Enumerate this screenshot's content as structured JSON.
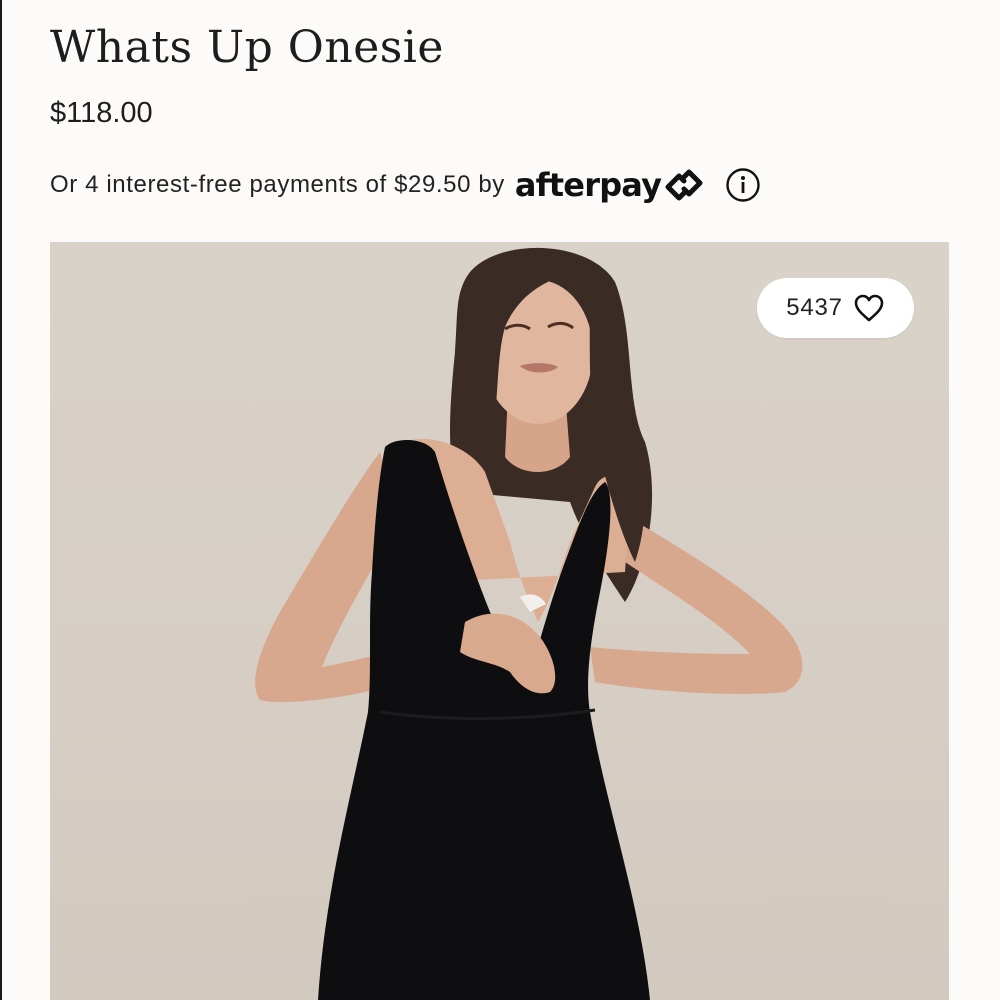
{
  "product": {
    "title": "Whats Up Onesie",
    "price": "$118.00"
  },
  "payments": {
    "text": "Or 4 interest-free payments of $29.50 by",
    "provider": "afterpay",
    "provider_icon": "afterpay-arrows-icon",
    "info_icon": "info-icon"
  },
  "image": {
    "like_count": "5437",
    "like_icon": "heart-outline-icon"
  },
  "colors": {
    "page_background": "#fcfbf9",
    "image_background": "#d8d0c6",
    "text": "#1d1d1d",
    "garment": "#0e0e10"
  }
}
